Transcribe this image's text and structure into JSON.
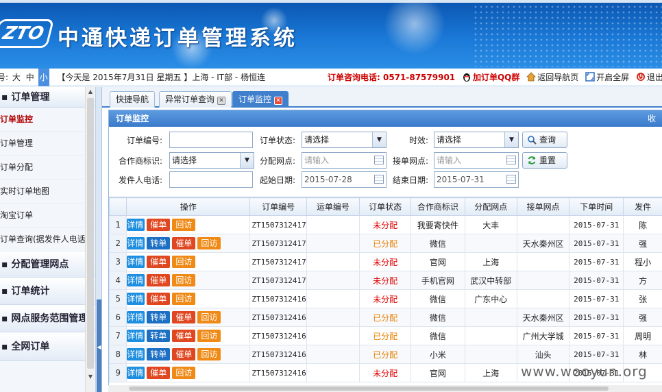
{
  "header": {
    "logo_text": "ZTO",
    "title": "中通快递订单管理系统"
  },
  "infobar": {
    "font_label": "号:",
    "font_sizes": [
      "大",
      "中",
      "小"
    ],
    "date_info": "【今天是 2015年7月31日 星期五 】上海 - IT部 - 杨恒连",
    "hotline": "订单咨询电话: 0571-87579901",
    "links": {
      "qq": "加订单QQ群",
      "back": "返回导航页",
      "fullscreen": "开启全屏",
      "logout": "退出系统"
    }
  },
  "sidebar": {
    "groups": [
      {
        "label": "订单管理",
        "items": [
          {
            "label": "订单监控",
            "active": true
          },
          {
            "label": "订单管理"
          },
          {
            "label": "订单分配"
          },
          {
            "label": "实时订单地图"
          },
          {
            "label": "淘宝订单"
          },
          {
            "label": "订单查询(据发件人电话)"
          }
        ]
      },
      {
        "label": "分配管理网点"
      },
      {
        "label": "订单统计"
      },
      {
        "label": "网点服务范围管理"
      },
      {
        "label": "全网订单"
      }
    ]
  },
  "tabs": [
    {
      "label": "快捷导航",
      "closable": false
    },
    {
      "label": "异常订单查询",
      "closable": true
    },
    {
      "label": "订单监控",
      "closable": true,
      "active": true
    }
  ],
  "panel": {
    "title": "订单监控",
    "collapse_label": "收缩"
  },
  "filters": {
    "order_no": {
      "label": "订单编号:",
      "value": ""
    },
    "order_status": {
      "label": "订单状态:",
      "value": "请选择"
    },
    "timeliness": {
      "label": "时效:",
      "value": "请选择"
    },
    "partner": {
      "label": "合作商标识:",
      "value": "请选择"
    },
    "assign_site": {
      "label": "分配网点:",
      "placeholder": "请输入"
    },
    "receive_site": {
      "label": "接单网点:",
      "placeholder": "请输入"
    },
    "sender_phone": {
      "label": "发件人电话:",
      "value": ""
    },
    "start_date": {
      "label": "起始日期:",
      "value": "2015-07-28"
    },
    "end_date": {
      "label": "结束日期:",
      "value": "2015-07-31"
    },
    "search_button": "查询",
    "reset_button": "重置"
  },
  "grid": {
    "columns": [
      "操作",
      "订单编号",
      "运单编号",
      "订单状态",
      "合作商标识",
      "分配网点",
      "接单网点",
      "下单时间",
      "发件"
    ],
    "action_labels": {
      "detail": "详情",
      "transfer": "转单",
      "urge": "催单",
      "visit": "回访"
    },
    "rows": [
      {
        "n": "1",
        "actions": [
          "detail",
          "urge",
          "visit"
        ],
        "order_no": "ZT1507312417",
        "waybill": "",
        "status": "未分配",
        "status_color": "#e00000",
        "partner": "我要寄快件",
        "assign": "大丰",
        "receive": "",
        "time": "2015-07-31",
        "sender": "陈"
      },
      {
        "n": "2",
        "actions": [
          "detail",
          "transfer",
          "urge",
          "visit"
        ],
        "order_no": "ZT1507312417",
        "waybill": "",
        "status": "已分配",
        "status_color": "#e88000",
        "partner": "微信",
        "assign": "",
        "receive": "天水秦州区",
        "time": "2015-07-31",
        "sender": "强"
      },
      {
        "n": "3",
        "actions": [
          "detail",
          "urge",
          "visit"
        ],
        "order_no": "ZT1507312417",
        "waybill": "",
        "status": "未分配",
        "status_color": "#e00000",
        "partner": "官网",
        "assign": "上海",
        "receive": "",
        "time": "2015-07-31",
        "sender": "程小"
      },
      {
        "n": "4",
        "actions": [
          "detail",
          "urge",
          "visit"
        ],
        "order_no": "ZT1507312417",
        "waybill": "",
        "status": "未分配",
        "status_color": "#e00000",
        "partner": "手机官网",
        "assign": "武汉中转部",
        "receive": "",
        "time": "2015-07-31",
        "sender": "方"
      },
      {
        "n": "5",
        "actions": [
          "detail",
          "urge",
          "visit"
        ],
        "order_no": "ZT1507312416",
        "waybill": "",
        "status": "未分配",
        "status_color": "#e00000",
        "partner": "微信",
        "assign": "广东中心",
        "receive": "",
        "time": "2015-07-31",
        "sender": "张"
      },
      {
        "n": "6",
        "actions": [
          "detail",
          "transfer",
          "urge",
          "visit"
        ],
        "order_no": "ZT1507312416",
        "waybill": "",
        "status": "已分配",
        "status_color": "#e88000",
        "partner": "微信",
        "assign": "",
        "receive": "天水秦州区",
        "time": "2015-07-31",
        "sender": "强"
      },
      {
        "n": "7",
        "actions": [
          "detail",
          "transfer",
          "urge",
          "visit"
        ],
        "order_no": "ZT1507312416",
        "waybill": "",
        "status": "已分配",
        "status_color": "#e88000",
        "partner": "微信",
        "assign": "",
        "receive": "广州大学城",
        "time": "2015-07-31",
        "sender": "周明"
      },
      {
        "n": "8",
        "actions": [
          "detail",
          "transfer",
          "urge",
          "visit"
        ],
        "order_no": "ZT1507312416",
        "waybill": "",
        "status": "已分配",
        "status_color": "#e88000",
        "partner": "小米",
        "assign": "",
        "receive": "汕头",
        "time": "2015-07-31",
        "sender": "林"
      },
      {
        "n": "9",
        "actions": [
          "detail",
          "urge",
          "visit"
        ],
        "order_no": "ZT1507312416",
        "waybill": "",
        "status": "未分配",
        "status_color": "#e00000",
        "partner": "官网",
        "assign": "上海",
        "receive": "",
        "time": "2015-07-31",
        "sender": ""
      }
    ]
  },
  "watermark": "www.wooyun.org",
  "colors": {
    "banner": "#1a78d6",
    "unassigned": "#e00000",
    "assigned": "#e88000",
    "detail_btn": "#1d8ee0",
    "transfer_btn": "#1d6fc4",
    "urge_btn": "#e0461f",
    "visit_btn": "#f08a16"
  }
}
